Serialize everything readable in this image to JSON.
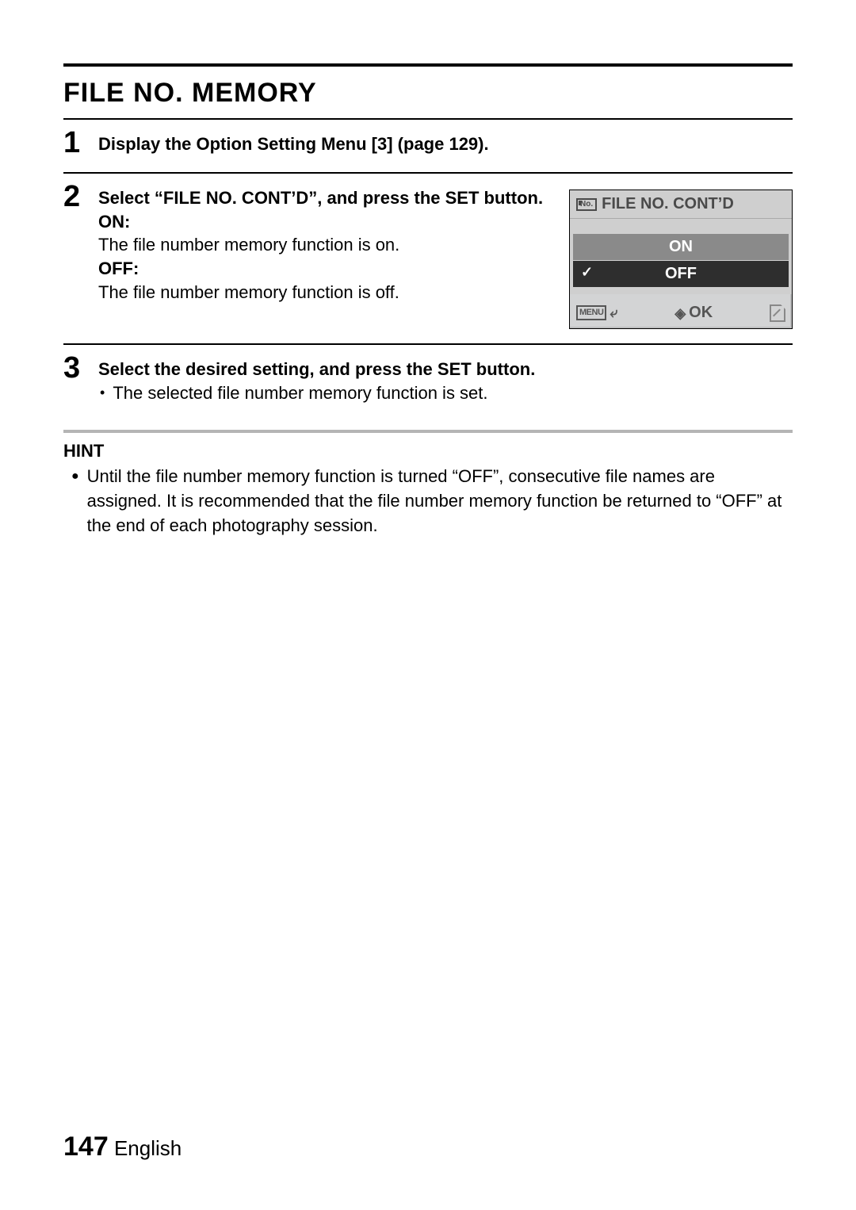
{
  "title": "FILE NO. MEMORY",
  "steps": {
    "s1": {
      "num": "1",
      "text": "Display the Option Setting Menu [3] (page 129)."
    },
    "s2": {
      "num": "2",
      "lead": "Select “FILE NO. CONT’D”, and press the SET button.",
      "on_label": "ON:",
      "on_desc": "The file number memory function is on.",
      "off_label": "OFF:",
      "off_desc": "The file number memory function is off."
    },
    "s3": {
      "num": "3",
      "lead": "Select the desired setting, and press the SET button.",
      "bullet": "The selected file number memory function is set."
    }
  },
  "lcd": {
    "icon_label": "No.",
    "title": "FILE NO. CONT’D",
    "option_on": "ON",
    "option_off": "OFF",
    "menu": "MENU",
    "ok": "OK"
  },
  "hint": {
    "label": "HINT",
    "text": "Until the file number memory function is turned “OFF”, consecutive file names are assigned. It is recommended that the file number memory function be returned to “OFF” at the end of each photography session."
  },
  "footer": {
    "page": "147",
    "lang": "English"
  }
}
